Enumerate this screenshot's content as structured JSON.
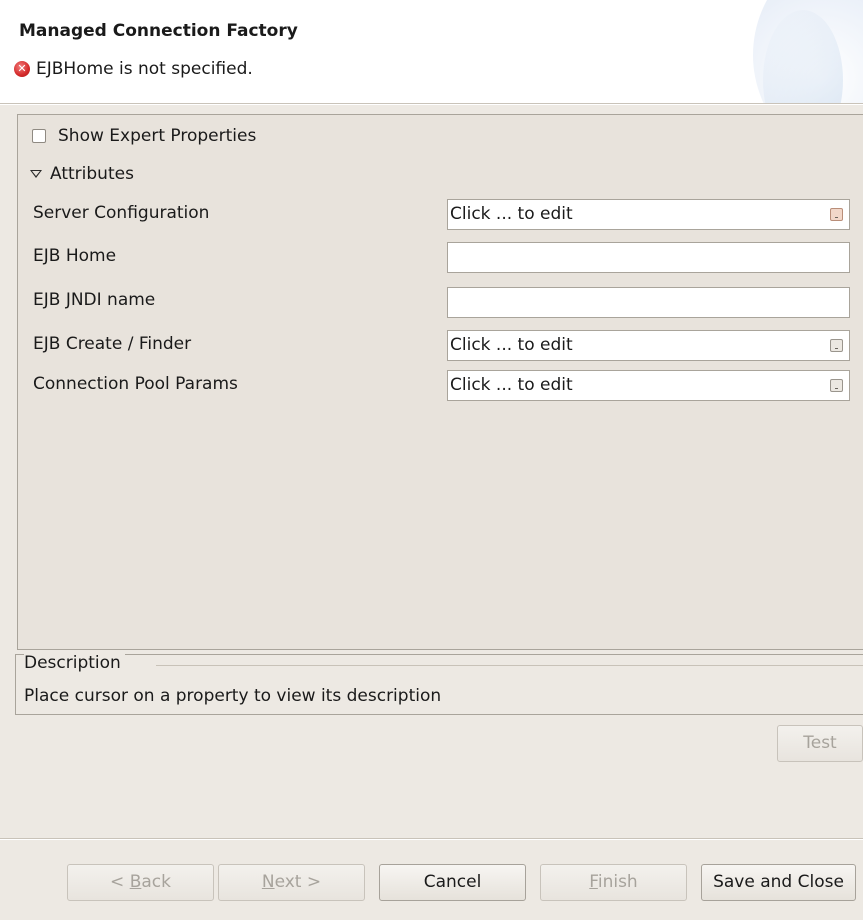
{
  "header": {
    "title": "Managed Connection Factory",
    "message": "EJBHome is not specified.",
    "message_icon": "error-icon",
    "error_glyph": "✕"
  },
  "properties": {
    "show_expert_label": "Show Expert Properties",
    "show_expert_checked": false,
    "section_label": "Attributes",
    "rows": [
      {
        "label": "Server Configuration",
        "value": "Click ... to edit",
        "has_button": true
      },
      {
        "label": "EJB Home",
        "value": "",
        "has_button": false
      },
      {
        "label": "EJB JNDI name",
        "value": "",
        "has_button": false
      },
      {
        "label": "EJB Create / Finder",
        "value": "Click ... to edit",
        "has_button": true
      },
      {
        "label": "Connection Pool Params",
        "value": "Click ... to edit",
        "has_button": true
      }
    ]
  },
  "description": {
    "title": "Description",
    "text": "Place cursor on a property to view its description"
  },
  "buttons": {
    "test": "Test",
    "back_prefix": "< ",
    "back_mnemonic": "B",
    "back_rest": "ack",
    "next_mnemonic": "N",
    "next_rest": "ext >",
    "cancel": "Cancel",
    "finish_mnemonic": "F",
    "finish_rest": "inish",
    "save_close": "Save and Close"
  }
}
